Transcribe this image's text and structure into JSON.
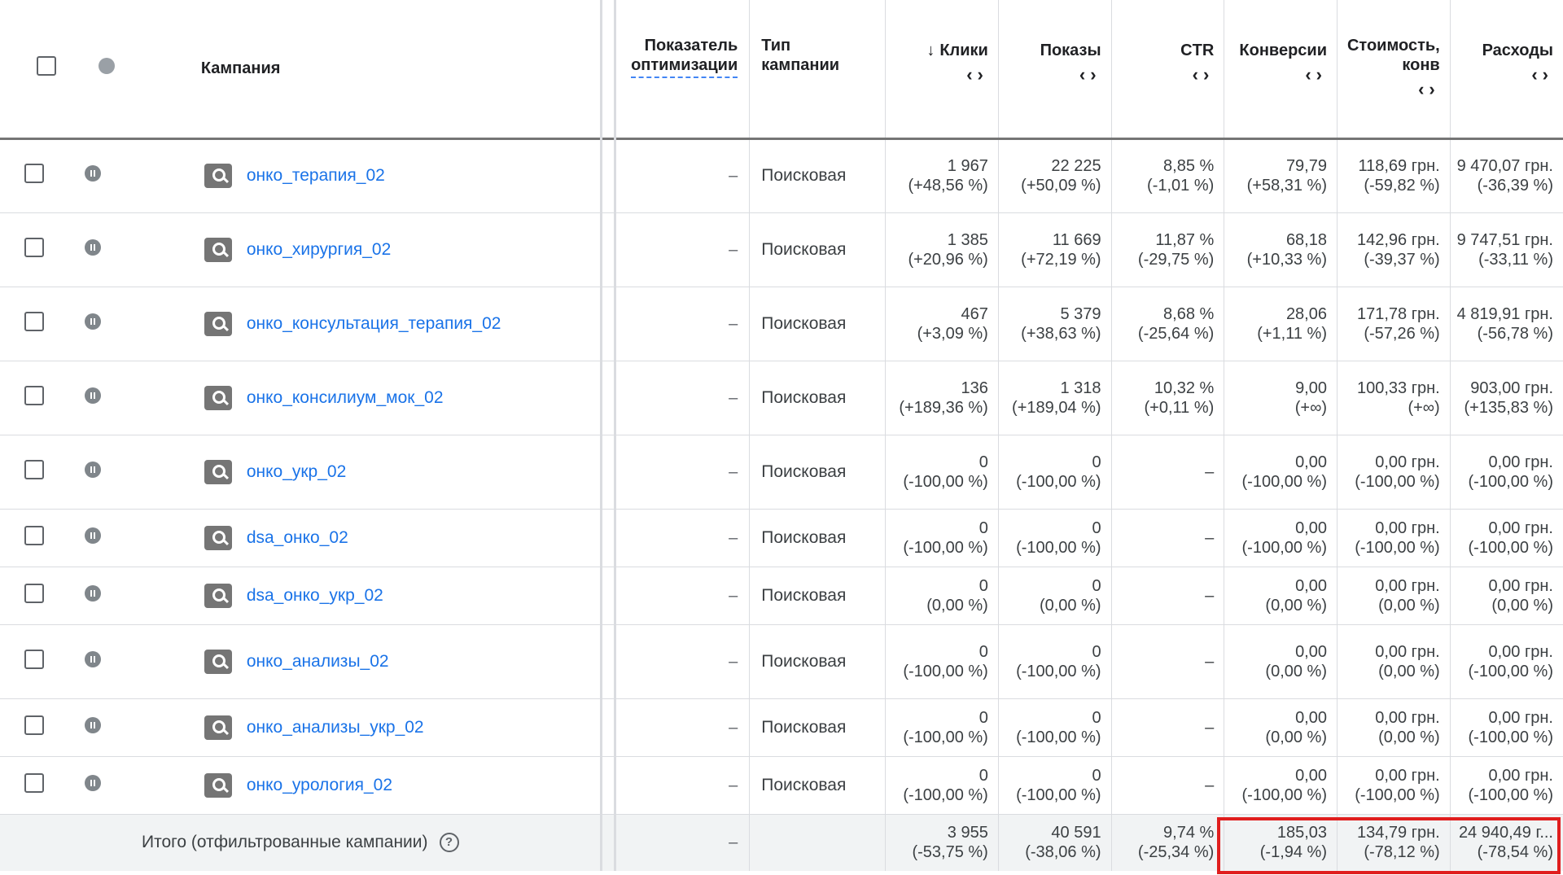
{
  "header": {
    "campaign": "Кампания",
    "optimization_line1": "Показатель",
    "optimization_line2": "оптимизации",
    "type_line1": "Тип",
    "type_line2": "кампании",
    "clicks": "Клики",
    "impressions": "Показы",
    "ctr": "CTR",
    "conversions": "Конверсии",
    "cost_conv_line1": "Стоимость,",
    "cost_conv_line2": "конв",
    "spend": "Расходы",
    "sort_arrows": "‹›",
    "sort_down": "↓"
  },
  "rows": [
    {
      "name": "онко_терапия_02",
      "opt": "–",
      "type": "Поисковая",
      "clicks": "1 967",
      "clicks_d": "(+48,56 %)",
      "impr": "22 225",
      "impr_d": "(+50,09 %)",
      "ctr": "8,85 %",
      "ctr_d": "(-1,01 %)",
      "conv": "79,79",
      "conv_d": "(+58,31 %)",
      "cpc": "118,69 грн.",
      "cpc_d": "(-59,82 %)",
      "spend": "9 470,07 грн.",
      "spend_d": "(-36,39 %)"
    },
    {
      "name": "онко_хирургия_02",
      "opt": "–",
      "type": "Поисковая",
      "clicks": "1 385",
      "clicks_d": "(+20,96 %)",
      "impr": "11 669",
      "impr_d": "(+72,19 %)",
      "ctr": "11,87 %",
      "ctr_d": "(-29,75 %)",
      "conv": "68,18",
      "conv_d": "(+10,33 %)",
      "cpc": "142,96 грн.",
      "cpc_d": "(-39,37 %)",
      "spend": "9 747,51 грн.",
      "spend_d": "(-33,11 %)"
    },
    {
      "name": "онко_консультация_терапия_02",
      "opt": "–",
      "type": "Поисковая",
      "clicks": "467",
      "clicks_d": "(+3,09 %)",
      "impr": "5 379",
      "impr_d": "(+38,63 %)",
      "ctr": "8,68 %",
      "ctr_d": "(-25,64 %)",
      "conv": "28,06",
      "conv_d": "(+1,11 %)",
      "cpc": "171,78 грн.",
      "cpc_d": "(-57,26 %)",
      "spend": "4 819,91 грн.",
      "spend_d": "(-56,78 %)"
    },
    {
      "name": "онко_консилиум_мок_02",
      "opt": "–",
      "type": "Поисковая",
      "clicks": "136",
      "clicks_d": "(+189,36 %)",
      "impr": "1 318",
      "impr_d": "(+189,04 %)",
      "ctr": "10,32 %",
      "ctr_d": "(+0,11 %)",
      "conv": "9,00",
      "conv_d": "(+∞)",
      "cpc": "100,33 грн.",
      "cpc_d": "(+∞)",
      "spend": "903,00 грн.",
      "spend_d": "(+135,83 %)"
    },
    {
      "name": "онко_укр_02",
      "opt": "–",
      "type": "Поисковая",
      "clicks": "0",
      "clicks_d": "(-100,00 %)",
      "impr": "0",
      "impr_d": "(-100,00 %)",
      "ctr": "–",
      "ctr_d": "",
      "conv": "0,00",
      "conv_d": "(-100,00 %)",
      "cpc": "0,00 грн.",
      "cpc_d": "(-100,00 %)",
      "spend": "0,00 грн.",
      "spend_d": "(-100,00 %)"
    },
    {
      "name": "dsa_онко_02",
      "opt": "–",
      "type": "Поисковая",
      "clicks": "0",
      "clicks_d": "(-100,00 %)",
      "impr": "0",
      "impr_d": "(-100,00 %)",
      "ctr": "–",
      "ctr_d": "",
      "conv": "0,00",
      "conv_d": "(-100,00 %)",
      "cpc": "0,00 грн.",
      "cpc_d": "(-100,00 %)",
      "spend": "0,00 грн.",
      "spend_d": "(-100,00 %)"
    },
    {
      "name": "dsa_онко_укр_02",
      "opt": "–",
      "type": "Поисковая",
      "clicks": "0",
      "clicks_d": "(0,00 %)",
      "impr": "0",
      "impr_d": "(0,00 %)",
      "ctr": "–",
      "ctr_d": "",
      "conv": "0,00",
      "conv_d": "(0,00 %)",
      "cpc": "0,00 грн.",
      "cpc_d": "(0,00 %)",
      "spend": "0,00 грн.",
      "spend_d": "(0,00 %)"
    },
    {
      "name": "онко_анализы_02",
      "opt": "–",
      "type": "Поисковая",
      "clicks": "0",
      "clicks_d": "(-100,00 %)",
      "impr": "0",
      "impr_d": "(-100,00 %)",
      "ctr": "–",
      "ctr_d": "",
      "conv": "0,00",
      "conv_d": "(0,00 %)",
      "cpc": "0,00 грн.",
      "cpc_d": "(0,00 %)",
      "spend": "0,00 грн.",
      "spend_d": "(-100,00 %)"
    },
    {
      "name": "онко_анализы_укр_02",
      "opt": "–",
      "type": "Поисковая",
      "clicks": "0",
      "clicks_d": "(-100,00 %)",
      "impr": "0",
      "impr_d": "(-100,00 %)",
      "ctr": "–",
      "ctr_d": "",
      "conv": "0,00",
      "conv_d": "(0,00 %)",
      "cpc": "0,00 грн.",
      "cpc_d": "(0,00 %)",
      "spend": "0,00 грн.",
      "spend_d": "(-100,00 %)"
    },
    {
      "name": "онко_урология_02",
      "opt": "–",
      "type": "Поисковая",
      "clicks": "0",
      "clicks_d": "(-100,00 %)",
      "impr": "0",
      "impr_d": "(-100,00 %)",
      "ctr": "–",
      "ctr_d": "",
      "conv": "0,00",
      "conv_d": "(-100,00 %)",
      "cpc": "0,00 грн.",
      "cpc_d": "(-100,00 %)",
      "spend": "0,00 грн.",
      "spend_d": "(-100,00 %)"
    }
  ],
  "total": {
    "label": "Итого (отфильтрованные кампании)",
    "help": "?",
    "opt": "–",
    "clicks": "3 955",
    "clicks_d": "(-53,75 %)",
    "impr": "40 591",
    "impr_d": "(-38,06 %)",
    "ctr": "9,74 %",
    "ctr_d": "(-25,34 %)",
    "conv": "185,03",
    "conv_d": "(-1,94 %)",
    "cpc": "134,79 грн.",
    "cpc_d": "(-78,12 %)",
    "spend": "24 940,49 г...",
    "spend_d": "(-78,54 %)"
  },
  "colors": {
    "link": "#1a73e8",
    "highlight": "#e01e1e",
    "total_bg": "#f1f3f4"
  }
}
